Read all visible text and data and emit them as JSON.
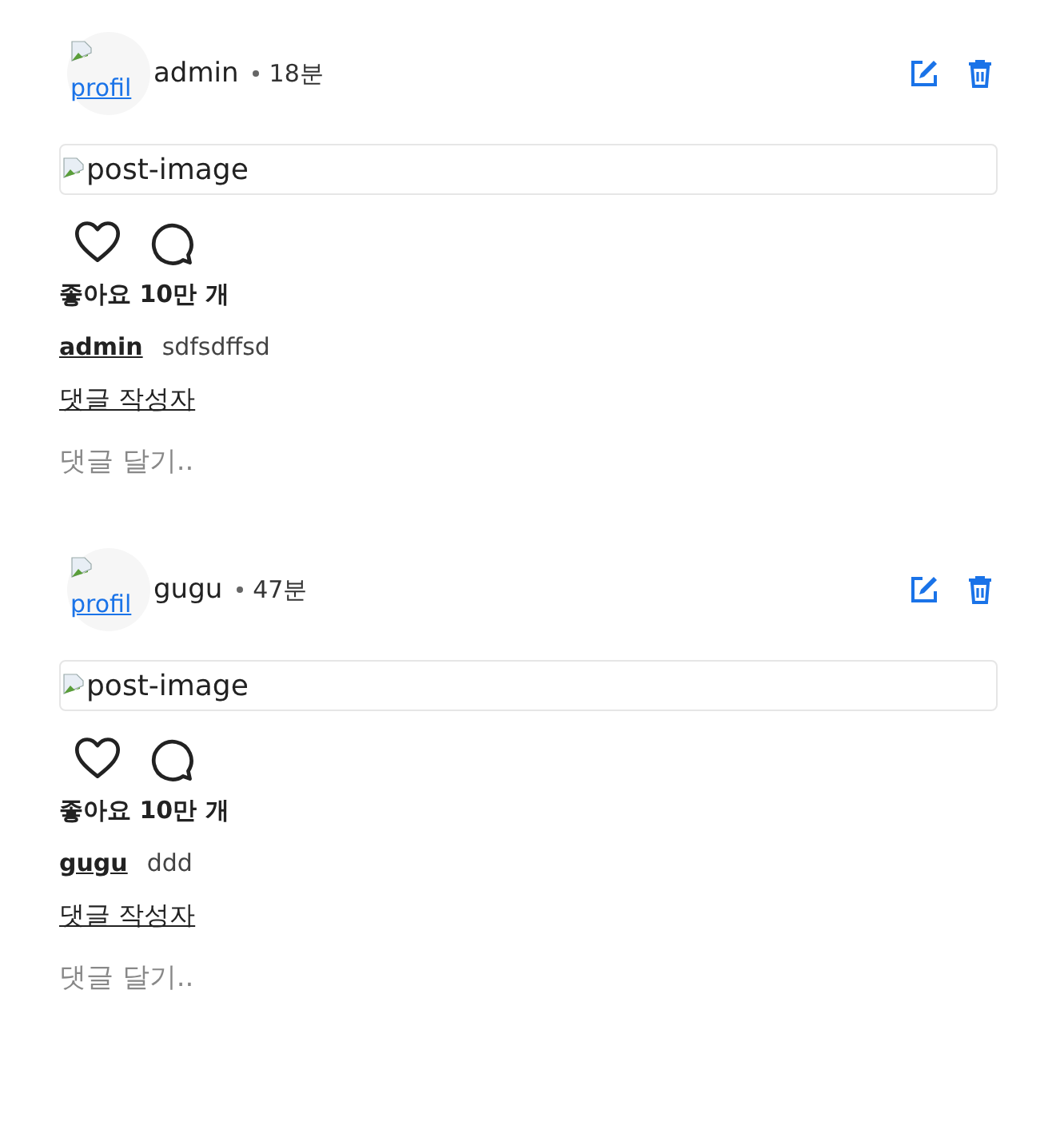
{
  "posts": [
    {
      "avatar_alt": "profil",
      "author": "admin",
      "time": "18분",
      "image_alt": "post-image",
      "likes": "좋아요 10만 개",
      "caption_author": "admin",
      "caption": "sdfsdffsd",
      "comment_author": "댓글 작성자",
      "comment_placeholder": "댓글 달기.."
    },
    {
      "avatar_alt": "profil",
      "author": "gugu",
      "time": "47분",
      "image_alt": "post-image",
      "likes": "좋아요 10만 개",
      "caption_author": "gugu",
      "caption": "ddd",
      "comment_author": "댓글 작성자",
      "comment_placeholder": "댓글 달기.."
    }
  ]
}
